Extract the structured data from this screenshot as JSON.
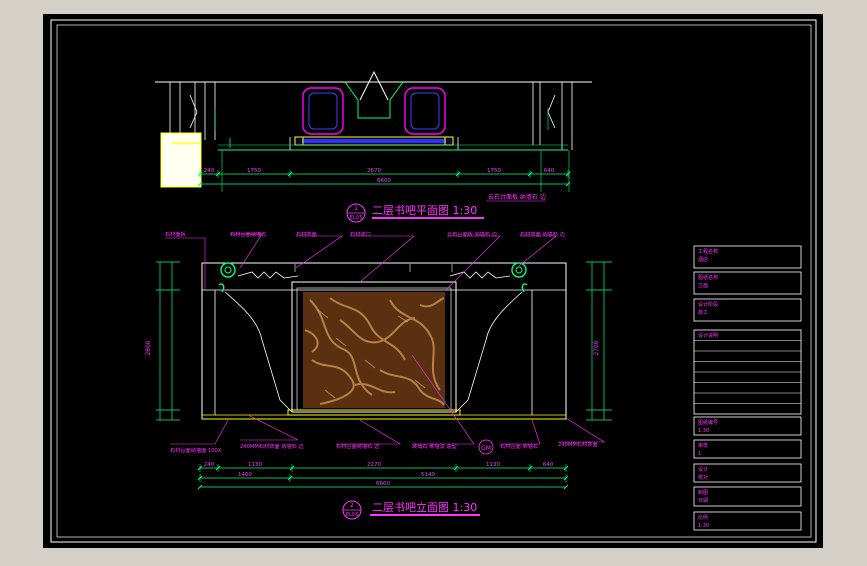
{
  "theme": {
    "ui_bg": "#d4d0c8",
    "canvas": "#000000",
    "frame": "#ffffff",
    "dim": "#00ff7f",
    "annot": "#ff33ff",
    "cyan": "#00ffff",
    "magenta": "#ff00ff",
    "blue": "#4040ff",
    "yellow": "#ffff00",
    "brown": "#5a3010"
  },
  "plan": {
    "title": "二层书吧平面图 1:30",
    "marker_top": "1",
    "marker_bottom": "EL03",
    "dims": [
      "240",
      "1750",
      "2670",
      "1750",
      "640"
    ],
    "total": "6600",
    "note": "云石台面板 纳墙石 边"
  },
  "elevation": {
    "title": "二层书吧立面图 1:30",
    "marker_top": "2",
    "marker_bottom": "EL03",
    "top_notes": [
      "石材面板",
      "石材台面纳墙石",
      "石材饰面",
      "石材收口",
      "云石台面板 纳墙石 边",
      "石材饰面 纳墙石 边"
    ],
    "bottom_notes": [
      "石材台面纳墙面 100X",
      "240MM石材饰面 纳墙石 边",
      "石材台面纳墙石 边",
      "玻璃石 刷墙漆 造型",
      "石材台面 纳墙石",
      "240MM石材饰面"
    ],
    "dims_row1": [
      "240",
      "1130",
      "2270",
      "1130",
      "640"
    ],
    "dims_row2": [
      "1460",
      "5140"
    ],
    "total": "6600",
    "height_left": "2800",
    "height_right": "2700",
    "inner_label": "GM"
  },
  "title_block": {
    "rows": [
      [
        "工程名称",
        "酒店"
      ],
      [
        "图纸名称",
        "立面"
      ],
      [
        "设计阶段",
        "施工"
      ],
      [
        "设计说明",
        ""
      ],
      [
        "图纸编号",
        "1:30"
      ],
      [
        "审核",
        "1"
      ],
      [
        "设计",
        "校对"
      ],
      [
        "制图",
        "日期"
      ],
      [
        "比例",
        "1:30"
      ]
    ]
  }
}
